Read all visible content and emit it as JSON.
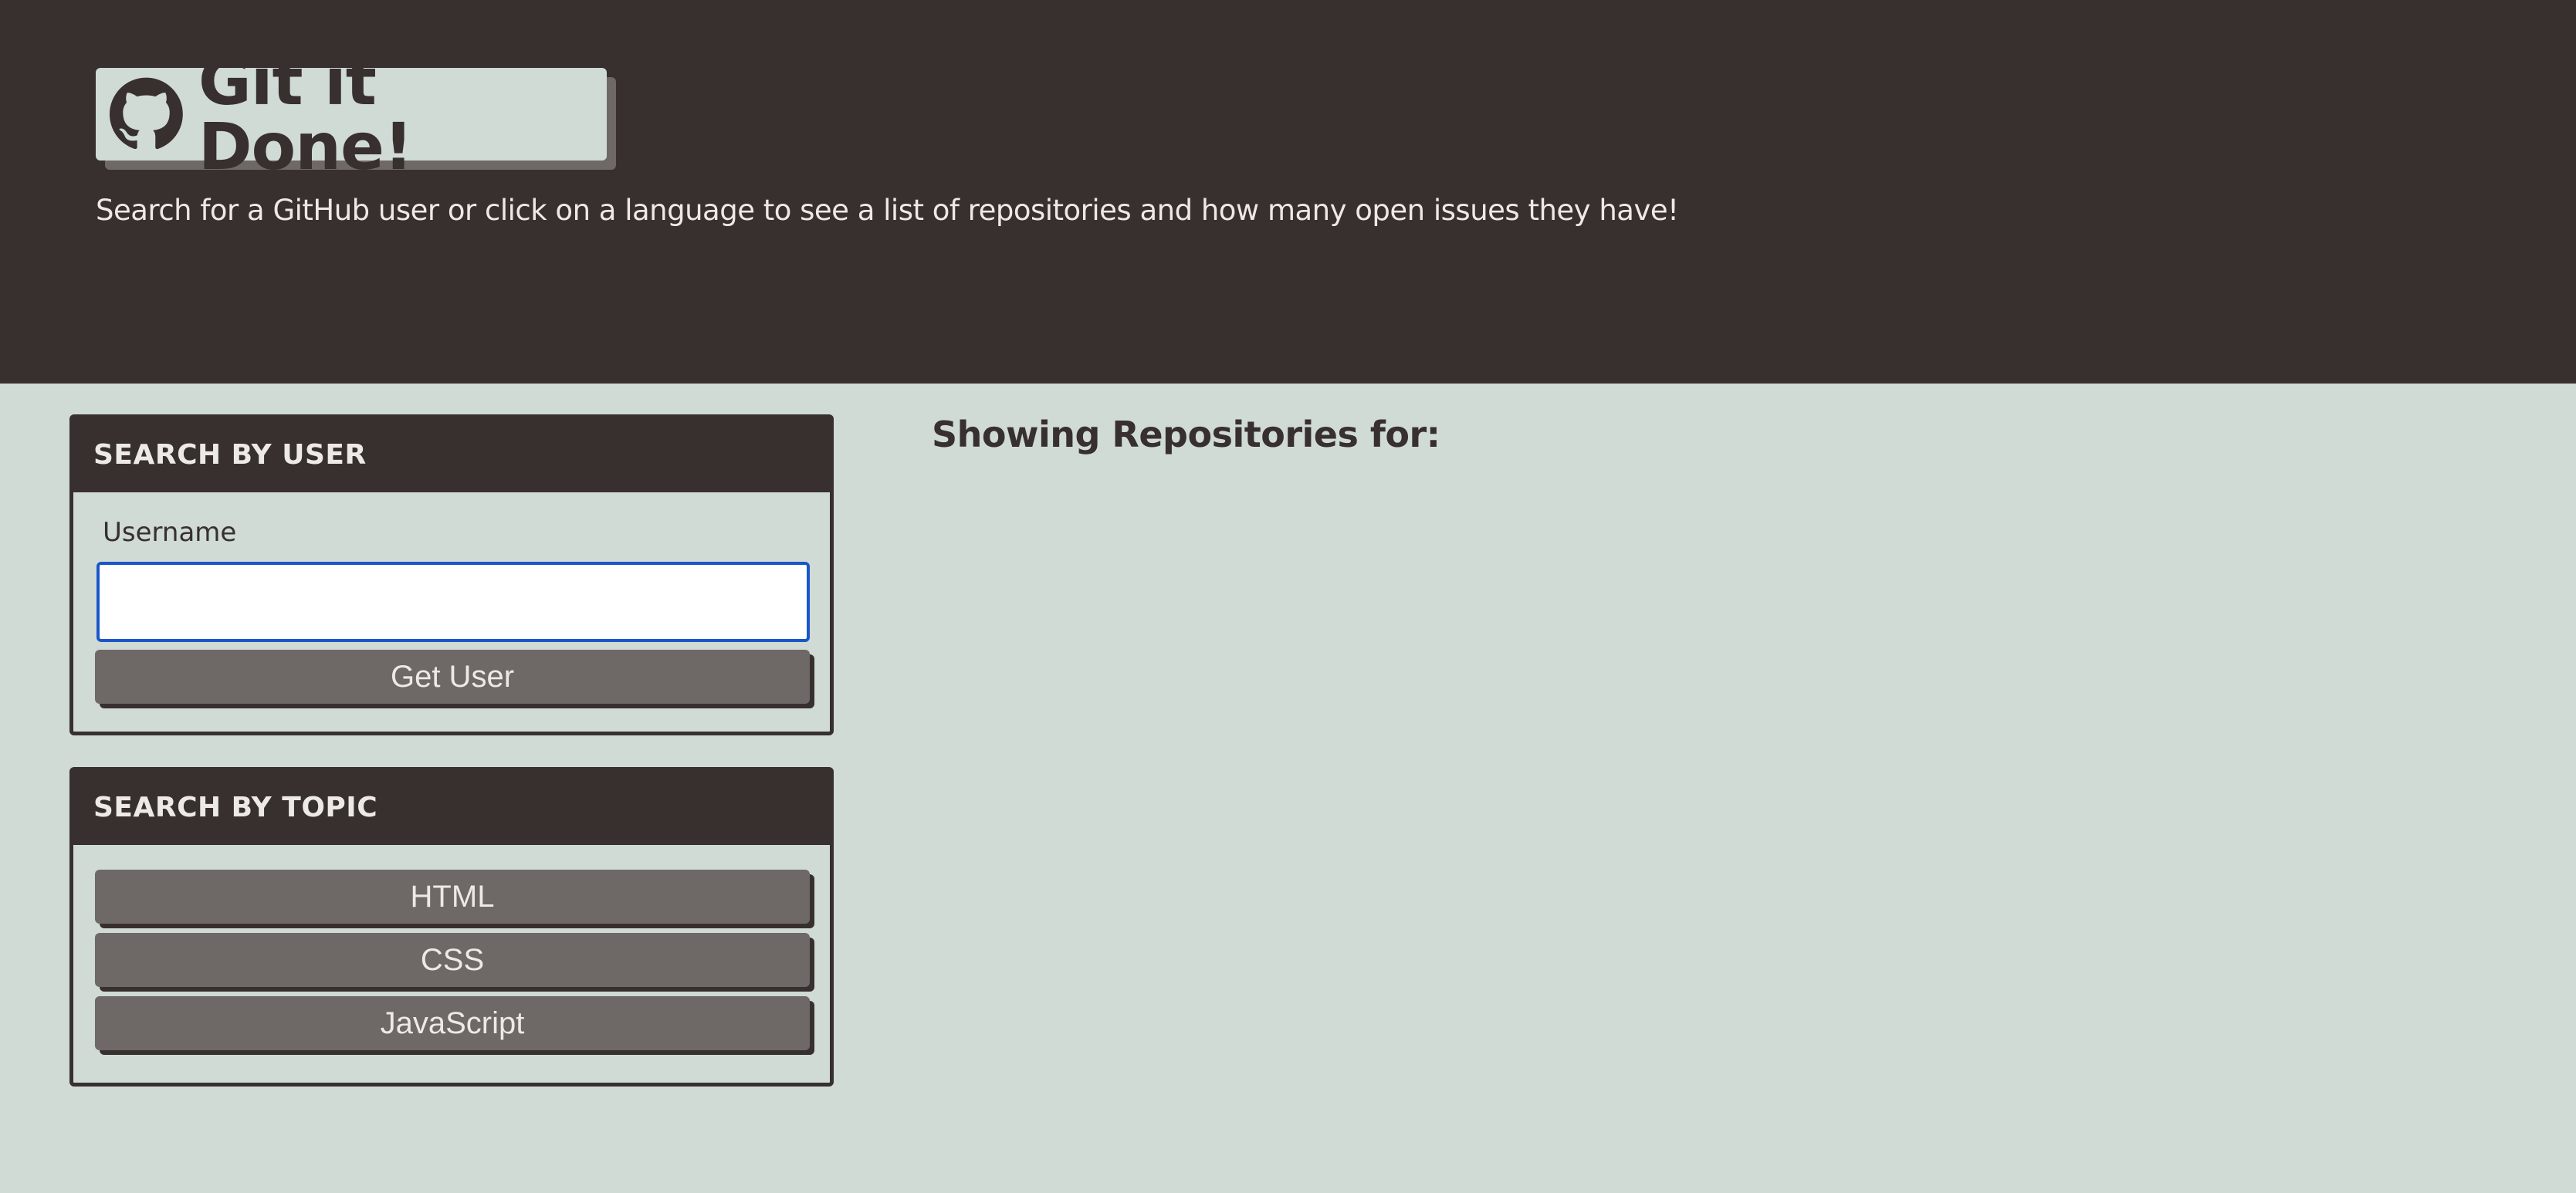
{
  "header": {
    "title": "Git it Done!",
    "logo_icon": "github-octocat-icon",
    "subtitle": "Search for a GitHub user or click on a language to see a list of repositories and how many open issues they have!"
  },
  "user_search": {
    "heading": "SEARCH BY USER",
    "field_label": "Username",
    "field_value": "",
    "button_label": "Get User"
  },
  "topic_search": {
    "heading": "SEARCH BY TOPIC",
    "buttons": [
      "HTML",
      "CSS",
      "JavaScript"
    ]
  },
  "results": {
    "heading": "Showing Repositories for:"
  },
  "colors": {
    "background": "#cfdbd4",
    "header_dark": "#382f2f",
    "button_gray": "#6e6867",
    "text_light": "#ede9e4",
    "focus_blue": "#1a56c9"
  }
}
